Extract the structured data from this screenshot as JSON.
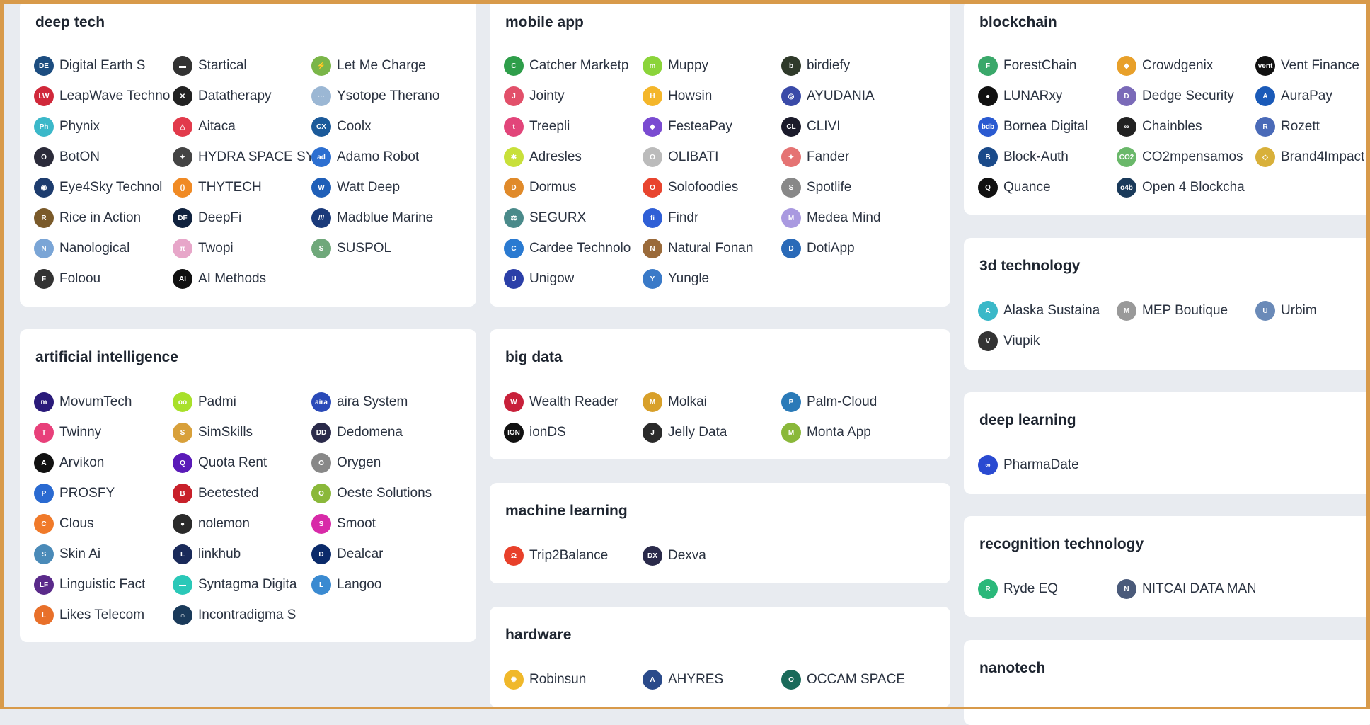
{
  "sections": {
    "deep_tech": {
      "title": "deep tech",
      "items": [
        {
          "name": "Digital Earth S",
          "color": "#1c4d80",
          "icon": "globe-logo",
          "mark": "DE"
        },
        {
          "name": "Startical",
          "color": "#333333",
          "icon": "startical-logo",
          "mark": "▬"
        },
        {
          "name": "Let Me Charge",
          "color": "#7ab648",
          "icon": "charge-logo",
          "mark": "⚡"
        },
        {
          "name": "LeapWave Techno",
          "color": "#d0283a",
          "icon": "leapwave-logo",
          "mark": "LW"
        },
        {
          "name": "Datatherapy",
          "color": "#222222",
          "icon": "datatherapy-logo",
          "mark": "✕"
        },
        {
          "name": "Ysotope Therano",
          "color": "#9bb7d4",
          "icon": "ysotope-logo",
          "mark": "···"
        },
        {
          "name": "Phynix",
          "color": "#3bb8c9",
          "icon": "phynix-logo",
          "mark": "Ph"
        },
        {
          "name": "Aitaca",
          "color": "#e23a4b",
          "icon": "aitaca-logo",
          "mark": "△"
        },
        {
          "name": "Coolx",
          "color": "#1b5a9a",
          "icon": "coolx-logo",
          "mark": "CX"
        },
        {
          "name": "BotON",
          "color": "#2b2b3a",
          "icon": "boton-logo",
          "mark": "O"
        },
        {
          "name": "HYDRA SPACE SYS",
          "color": "#444444",
          "icon": "hydra-logo",
          "mark": "✦"
        },
        {
          "name": "Adamo Robot",
          "color": "#2c6fd1",
          "icon": "adamo-logo",
          "mark": "ad"
        },
        {
          "name": "Eye4Sky Technol",
          "color": "#1d3c6e",
          "icon": "eye4sky-logo",
          "mark": "◉"
        },
        {
          "name": "THYTECH",
          "color": "#f08a24",
          "icon": "thytech-logo",
          "mark": "()"
        },
        {
          "name": "Watt Deep",
          "color": "#1f5fb8",
          "icon": "wattdeep-logo",
          "mark": "W"
        },
        {
          "name": "Rice in Action",
          "color": "#7a5a2a",
          "icon": "rice-logo",
          "mark": "R"
        },
        {
          "name": "DeepFi",
          "color": "#10223e",
          "icon": "deepfi-logo",
          "mark": "DF"
        },
        {
          "name": "Madblue Marine",
          "color": "#1a3a7a",
          "icon": "madblue-logo",
          "mark": "///"
        },
        {
          "name": "Nanological",
          "color": "#7aa5d6",
          "icon": "nanological-logo",
          "mark": "N"
        },
        {
          "name": "Twopi",
          "color": "#e7a6c9",
          "icon": "twopi-logo",
          "mark": "π"
        },
        {
          "name": "SUSPOL",
          "color": "#6fa87a",
          "icon": "suspol-logo",
          "mark": "S"
        },
        {
          "name": "Foloou",
          "color": "#333333",
          "icon": "foloou-logo",
          "mark": "F"
        },
        {
          "name": "AI Methods",
          "color": "#111111",
          "icon": "aimethods-logo",
          "mark": "AI"
        }
      ]
    },
    "mobile_app": {
      "title": "mobile app",
      "items": [
        {
          "name": "Catcher Marketp",
          "color": "#2e9e4a",
          "icon": "catcher-logo",
          "mark": "C"
        },
        {
          "name": "Muppy",
          "color": "#8bd43a",
          "icon": "muppy-logo",
          "mark": "m"
        },
        {
          "name": "birdiefy",
          "color": "#2f3a2a",
          "icon": "birdiefy-logo",
          "mark": "b"
        },
        {
          "name": "Jointy",
          "color": "#e2506a",
          "icon": "jointy-logo",
          "mark": "J"
        },
        {
          "name": "Howsin",
          "color": "#f4b62a",
          "icon": "howsin-logo",
          "mark": "H"
        },
        {
          "name": "AYUDANIA",
          "color": "#3a4aa8",
          "icon": "ayudania-logo",
          "mark": "◎"
        },
        {
          "name": "Treepli",
          "color": "#e2457a",
          "icon": "treepli-logo",
          "mark": "t"
        },
        {
          "name": "FesteaPay",
          "color": "#7a4bd1",
          "icon": "festeapay-logo",
          "mark": "◆"
        },
        {
          "name": "CLIVI",
          "color": "#1b1b2b",
          "icon": "clivi-logo",
          "mark": "CL"
        },
        {
          "name": "Adresles",
          "color": "#c8e03a",
          "icon": "adresles-logo",
          "mark": "✱"
        },
        {
          "name": "OLIBATI",
          "color": "#bbbbbb",
          "icon": "olibati-logo",
          "mark": "O"
        },
        {
          "name": "Fander",
          "color": "#e57373",
          "icon": "fander-logo",
          "mark": "✦"
        },
        {
          "name": "Dormus",
          "color": "#e08a2a",
          "icon": "dormus-logo",
          "mark": "D"
        },
        {
          "name": "Solofoodies",
          "color": "#e8442e",
          "icon": "solofoodies-logo",
          "mark": "O"
        },
        {
          "name": "Spotlife",
          "color": "#888888",
          "icon": "spotlife-logo",
          "mark": "S"
        },
        {
          "name": "SEGURX",
          "color": "#4a8a8a",
          "icon": "segurx-logo",
          "mark": "⚖"
        },
        {
          "name": "Findr",
          "color": "#2f5fd6",
          "icon": "findr-logo",
          "mark": "fi"
        },
        {
          "name": "Medea Mind",
          "color": "#a999e0",
          "icon": "medea-logo",
          "mark": "M"
        },
        {
          "name": "Cardee Technolo",
          "color": "#2a7ad1",
          "icon": "cardee-logo",
          "mark": "C"
        },
        {
          "name": "Natural Fonan",
          "color": "#9a6a3a",
          "icon": "fonan-logo",
          "mark": "N"
        },
        {
          "name": "DotiApp",
          "color": "#2a6ab8",
          "icon": "dotiapp-logo",
          "mark": "D"
        },
        {
          "name": "Unigow",
          "color": "#2b3fa8",
          "icon": "unigow-logo",
          "mark": "U"
        },
        {
          "name": "Yungle",
          "color": "#3a7ac8",
          "icon": "yungle-logo",
          "mark": "Y"
        }
      ]
    },
    "blockchain": {
      "title": "blockchain",
      "items": [
        {
          "name": "ForestChain",
          "color": "#3aa86a",
          "icon": "forestchain-logo",
          "mark": "F"
        },
        {
          "name": "Crowdgenix",
          "color": "#e8a02a",
          "icon": "crowdgenix-logo",
          "mark": "◆"
        },
        {
          "name": "Vent Finance",
          "color": "#111111",
          "icon": "ventfinance-logo",
          "mark": "vent"
        },
        {
          "name": "LUNARxy",
          "color": "#111111",
          "icon": "lunarxy-logo",
          "mark": "●"
        },
        {
          "name": "Dedge Security",
          "color": "#7a6ab8",
          "icon": "dedge-logo",
          "mark": "D"
        },
        {
          "name": "AuraPay",
          "color": "#1a5ab8",
          "icon": "aurapay-logo",
          "mark": "A"
        },
        {
          "name": "Bornea Digital",
          "color": "#2a5ad1",
          "icon": "bornea-logo",
          "mark": "bdb"
        },
        {
          "name": "Chainbles",
          "color": "#222222",
          "icon": "chainbles-logo",
          "mark": "∞"
        },
        {
          "name": "Rozett",
          "color": "#4a6ab8",
          "icon": "rozett-logo",
          "mark": "R"
        },
        {
          "name": "Block-Auth",
          "color": "#1a4a8a",
          "icon": "blockauth-logo",
          "mark": "B"
        },
        {
          "name": "CO2mpensamos",
          "color": "#6ab86a",
          "icon": "co2-logo",
          "mark": "CO2"
        },
        {
          "name": "Brand4Impact",
          "color": "#d8b03a",
          "icon": "brand4impact-logo",
          "mark": "◇"
        },
        {
          "name": "Quance",
          "color": "#111111",
          "icon": "quance-logo",
          "mark": "Q"
        },
        {
          "name": "Open 4 Blockcha",
          "color": "#1a3a5a",
          "icon": "open4-logo",
          "mark": "o4b"
        }
      ]
    },
    "three_d": {
      "title": "3d technology",
      "items": [
        {
          "name": "Alaska Sustaina",
          "color": "#3ab8c8",
          "icon": "alaska-logo",
          "mark": "A"
        },
        {
          "name": "MEP Boutique",
          "color": "#999999",
          "icon": "mep-logo",
          "mark": "M"
        },
        {
          "name": "Urbim",
          "color": "#6a8ab8",
          "icon": "urbim-logo",
          "mark": "U"
        },
        {
          "name": "Viupik",
          "color": "#333333",
          "icon": "viupik-logo",
          "mark": "V"
        }
      ]
    },
    "ai": {
      "title": "artificial intelligence",
      "items": [
        {
          "name": "MovumTech",
          "color": "#2a1a7a",
          "icon": "movumtech-logo",
          "mark": "m"
        },
        {
          "name": "Padmi",
          "color": "#a8e02a",
          "icon": "padmi-logo",
          "mark": "oo"
        },
        {
          "name": "aira System",
          "color": "#2a4ab8",
          "icon": "aira-logo",
          "mark": "aira"
        },
        {
          "name": "Twinny",
          "color": "#e8407a",
          "icon": "twinny-logo",
          "mark": "T"
        },
        {
          "name": "SimSkills",
          "color": "#d8a03a",
          "icon": "simskills-logo",
          "mark": "S"
        },
        {
          "name": "Dedomena",
          "color": "#2a2a4a",
          "icon": "dedomena-logo",
          "mark": "DD"
        },
        {
          "name": "Arvikon",
          "color": "#111111",
          "icon": "arvikon-logo",
          "mark": "A"
        },
        {
          "name": "Quota Rent",
          "color": "#5a1ab8",
          "icon": "quotarent-logo",
          "mark": "Q"
        },
        {
          "name": "Orygen",
          "color": "#888888",
          "icon": "orygen-logo",
          "mark": "O"
        },
        {
          "name": "PROSFY",
          "color": "#2a6ad1",
          "icon": "prosfy-logo",
          "mark": "P"
        },
        {
          "name": "Beetested",
          "color": "#c8202a",
          "icon": "beetested-logo",
          "mark": "B"
        },
        {
          "name": "Oeste Solutions",
          "color": "#8ab83a",
          "icon": "oeste-logo",
          "mark": "O"
        },
        {
          "name": "Clous",
          "color": "#f07a2a",
          "icon": "clous-logo",
          "mark": "C"
        },
        {
          "name": "nolemon",
          "color": "#2a2a2a",
          "icon": "nolemon-logo",
          "mark": "●"
        },
        {
          "name": "Smoot",
          "color": "#d82aa8",
          "icon": "smoot-logo",
          "mark": "S"
        },
        {
          "name": "Skin Ai",
          "color": "#4a8ab8",
          "icon": "skinai-logo",
          "mark": "S"
        },
        {
          "name": "linkhub",
          "color": "#1a2a5a",
          "icon": "linkhub-logo",
          "mark": "L"
        },
        {
          "name": "Dealcar",
          "color": "#0a2a6a",
          "icon": "dealcar-logo",
          "mark": "D"
        },
        {
          "name": "Linguistic Fact",
          "color": "#5a2a8a",
          "icon": "linguistic-logo",
          "mark": "LF"
        },
        {
          "name": "Syntagma Digita",
          "color": "#2ac8b8",
          "icon": "syntagma-logo",
          "mark": "—"
        },
        {
          "name": "Langoo",
          "color": "#3a8ad1",
          "icon": "langoo-logo",
          "mark": "L"
        },
        {
          "name": "Likes Telecom",
          "color": "#e8702a",
          "icon": "likes-logo",
          "mark": "L"
        },
        {
          "name": "Incontradigma S",
          "color": "#1a3a5a",
          "icon": "incontradigma-logo",
          "mark": "∩"
        }
      ]
    },
    "big_data": {
      "title": "big data",
      "items": [
        {
          "name": "Wealth Reader",
          "color": "#c8203a",
          "icon": "wealthreader-logo",
          "mark": "W"
        },
        {
          "name": "Molkai",
          "color": "#d8a02a",
          "icon": "molkai-logo",
          "mark": "M"
        },
        {
          "name": "Palm-Cloud",
          "color": "#2a7ab8",
          "icon": "palmcloud-logo",
          "mark": "P"
        },
        {
          "name": "ionDS",
          "color": "#111111",
          "icon": "iondss-logo",
          "mark": "ION"
        },
        {
          "name": "Jelly Data",
          "color": "#2a2a2a",
          "icon": "jellydata-logo",
          "mark": "J"
        },
        {
          "name": "Monta App",
          "color": "#8ab83a",
          "icon": "monta-logo",
          "mark": "M"
        }
      ]
    },
    "deep_learning": {
      "title": "deep learning",
      "items": [
        {
          "name": "PharmaDate",
          "color": "#2a4ad1",
          "icon": "pharmadate-logo",
          "mark": "∞"
        }
      ]
    },
    "machine_learning": {
      "title": "machine learning",
      "items": [
        {
          "name": "Trip2Balance",
          "color": "#e8402a",
          "icon": "trip2balance-logo",
          "mark": "Ω"
        },
        {
          "name": "Dexva",
          "color": "#2a2a4a",
          "icon": "dexva-logo",
          "mark": "DX"
        }
      ]
    },
    "recognition": {
      "title": "recognition technology",
      "items": [
        {
          "name": "Ryde EQ",
          "color": "#2ab87a",
          "icon": "rydeeq-logo",
          "mark": "R"
        },
        {
          "name": "NITCAI DATA MAN",
          "color": "#4a5a7a",
          "icon": "nitcai-logo",
          "mark": "N"
        }
      ]
    },
    "hardware": {
      "title": "hardware",
      "items": [
        {
          "name": "Robinsun",
          "color": "#f0b82a",
          "icon": "robinsun-logo",
          "mark": "✺"
        },
        {
          "name": "AHYRES",
          "color": "#2a4a8a",
          "icon": "ahyres-logo",
          "mark": "A"
        },
        {
          "name": "OCCAM SPACE",
          "color": "#1a6a5a",
          "icon": "occam-logo",
          "mark": "O"
        }
      ]
    },
    "nanotech": {
      "title": "nanotech",
      "items": []
    }
  }
}
